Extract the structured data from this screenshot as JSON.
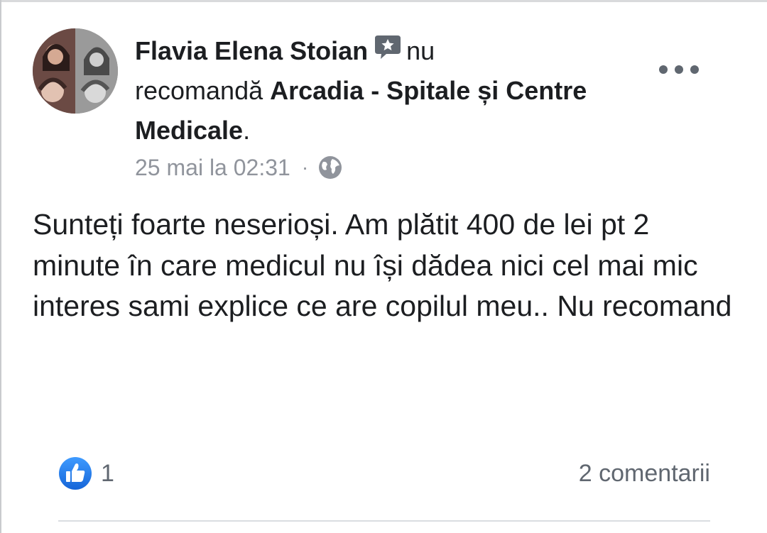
{
  "post": {
    "author": "Flavia Elena Stoian",
    "verb_part1": "nu",
    "verb_part2": "recomandă",
    "page_name": "Arcadia - Spitale și Centre Medicale",
    "trailing": ".",
    "timestamp": "25 mai la 02:31",
    "separator": "·",
    "privacy_icon": "globe-icon",
    "badge_icon": "review-badge-icon",
    "body": "Sunteți foarte neserioși. Am plătit 400 de lei pt 2 minute în care medicul nu își dădea nici cel mai mic interes sami explice ce are copilul meu.. Nu recomand",
    "reactions": {
      "icon": "like-icon",
      "count": "1"
    },
    "comments_label": "2 comentarii"
  },
  "colors": {
    "text_primary": "#1c1e21",
    "text_secondary": "#90949c",
    "like_blue": "#2d88ff",
    "divider": "#dadde1"
  }
}
